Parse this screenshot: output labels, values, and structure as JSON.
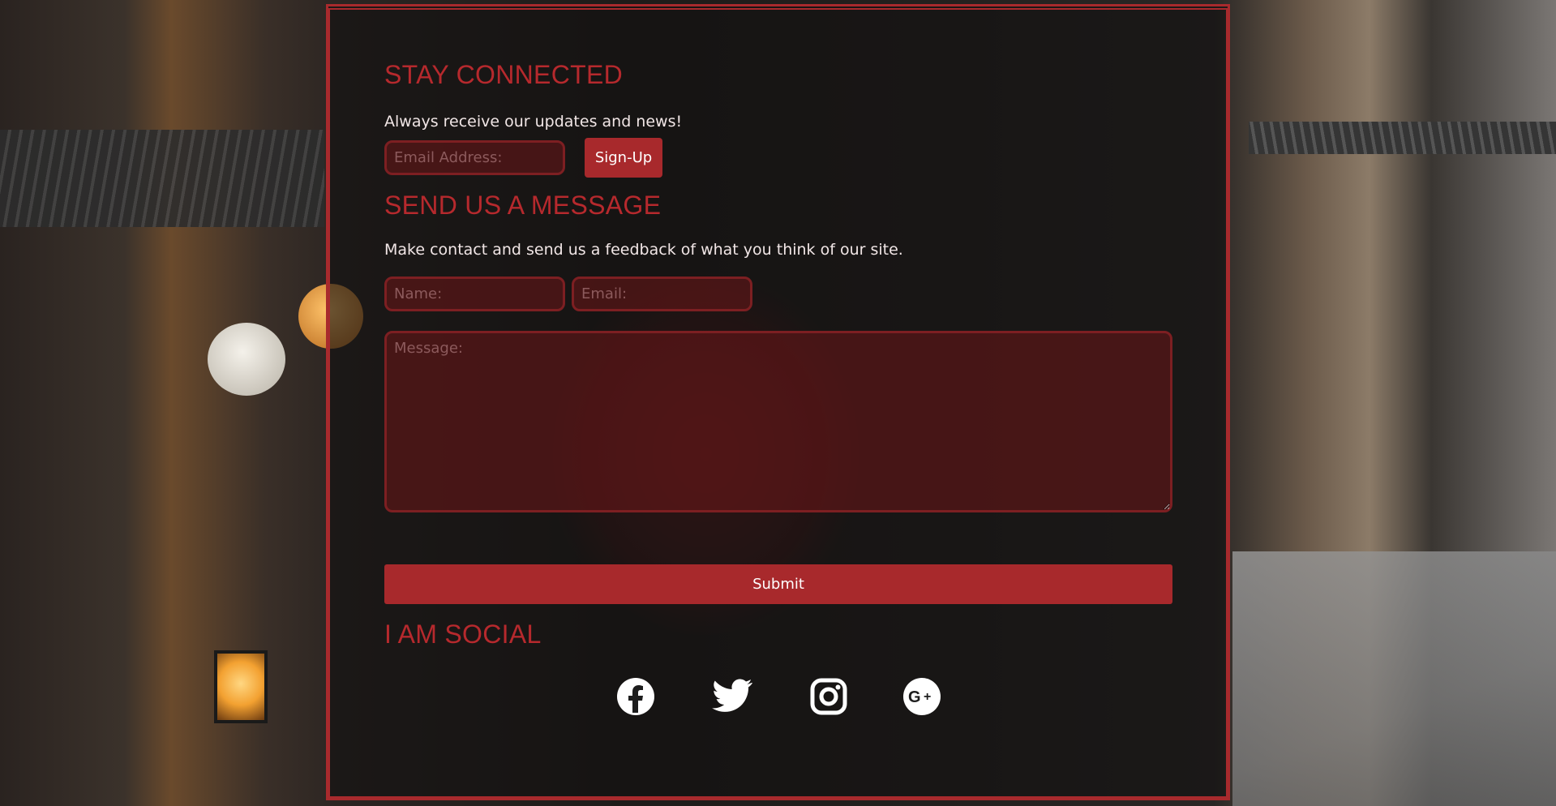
{
  "newsletter": {
    "title": "STAY CONNECTED",
    "description": "Always receive our updates and news!",
    "email_placeholder": "Email Address:",
    "signup_label": "Sign-Up"
  },
  "contact": {
    "title": "SEND US A MESSAGE",
    "description": "Make contact and send us a feedback of what you think of our site.",
    "name_placeholder": "Name:",
    "email_placeholder": "Email:",
    "message_placeholder": "Message:",
    "submit_label": "Submit"
  },
  "social": {
    "title": "I AM SOCIAL",
    "icons": [
      "facebook-icon",
      "twitter-icon",
      "instagram-icon",
      "google-plus-icon"
    ]
  },
  "colors": {
    "accent": "#a8292c",
    "heading": "#b6292d",
    "text": "#f1e6e6"
  }
}
